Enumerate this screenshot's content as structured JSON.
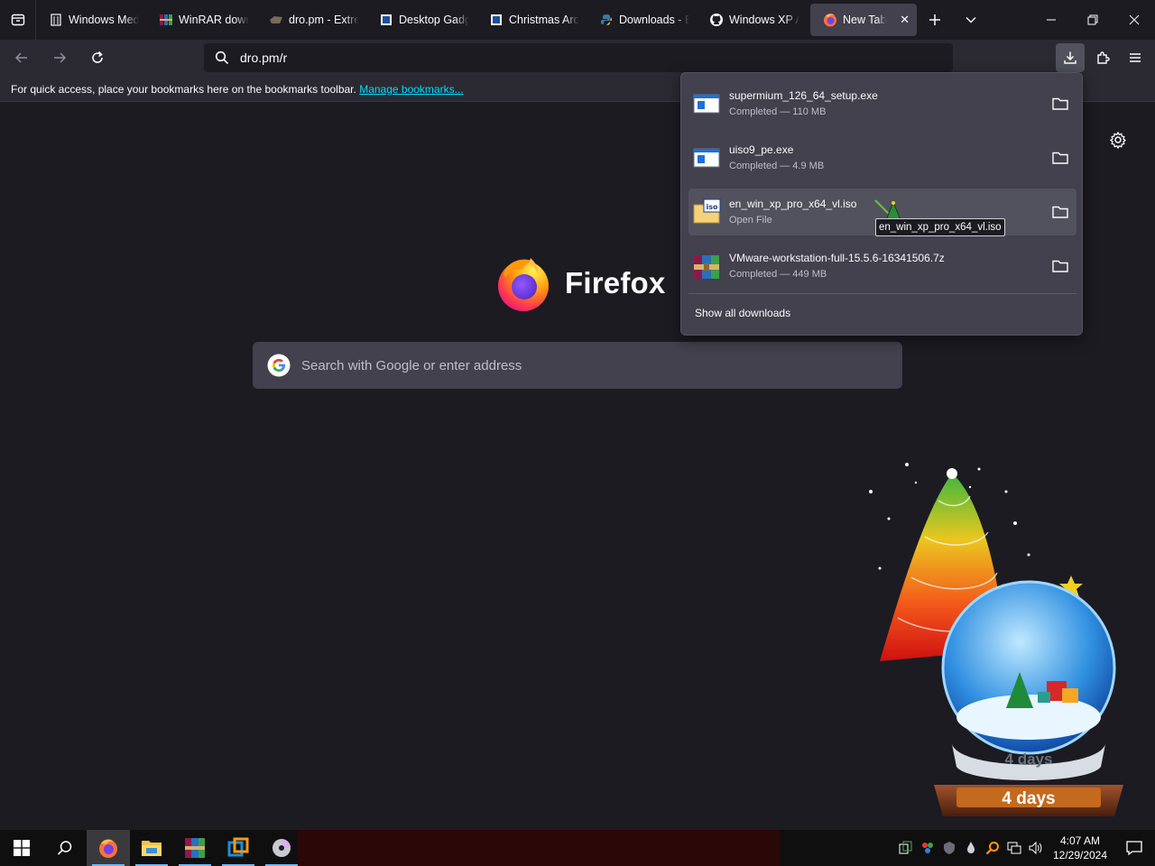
{
  "tabs": [
    {
      "title": "Windows Med",
      "icon": "building-icon"
    },
    {
      "title": "WinRAR down",
      "icon": "winrar-icon"
    },
    {
      "title": "dro.pm - Extre",
      "icon": "dropm-icon"
    },
    {
      "title": "Desktop Gadg",
      "icon": "gadget-icon"
    },
    {
      "title": "Christmas Arc",
      "icon": "gadget-icon"
    },
    {
      "title": "Downloads - B",
      "icon": "python-icon"
    },
    {
      "title": "Windows XP A",
      "icon": "github-icon"
    },
    {
      "title": "New Tab",
      "icon": "firefox-icon",
      "active": true
    }
  ],
  "address_bar": {
    "value": "dro.pm/r"
  },
  "bookmarks_bar": {
    "message": "For quick access, place your bookmarks here on the bookmarks toolbar.",
    "link": "Manage bookmarks..."
  },
  "newtab": {
    "brand": "Firefox",
    "search_placeholder": "Search with Google or enter address"
  },
  "downloads": {
    "items": [
      {
        "name": "supermium_126_64_setup.exe",
        "status": "Completed — 110 MB",
        "icon": "exe-file-icon"
      },
      {
        "name": "uiso9_pe.exe",
        "status": "Completed — 4.9 MB",
        "icon": "exe-file-icon"
      },
      {
        "name": "en_win_xp_pro_x64_vl.iso",
        "status": "Open File",
        "icon": "iso-file-icon"
      },
      {
        "name": "VMware-workstation-full-15.5.6-16341506.7z",
        "status": "Completed — 449 MB",
        "icon": "archive-file-icon"
      }
    ],
    "show_all": "Show all downloads",
    "tooltip": "en_win_xp_pro_x64_vl.iso"
  },
  "widget": {
    "countdown_top": "4 days",
    "countdown_bottom": "4 days"
  },
  "taskbar": {
    "apps": [
      "firefox-icon",
      "file-explorer-icon",
      "winrar-icon",
      "vmware-icon",
      "dvd-icon"
    ],
    "time": "4:07 AM",
    "date": "12/29/2024"
  },
  "colors": {
    "accent": "#00ddff",
    "panel": "#42414d",
    "toolbar": "#2b2a33",
    "background": "#1c1b22"
  }
}
